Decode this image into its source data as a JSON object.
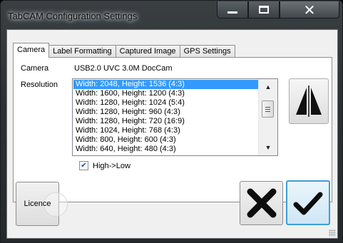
{
  "window": {
    "title": "TabCAM Configuration Settings"
  },
  "tabs": [
    {
      "label": "Camera",
      "active": true
    },
    {
      "label": "Label Formatting",
      "active": false
    },
    {
      "label": "Captured Image",
      "active": false
    },
    {
      "label": "GPS Settings",
      "active": false
    }
  ],
  "camera": {
    "label": "Camera",
    "value": "USB2.0 UVC 3.0M DocCam"
  },
  "resolution": {
    "label": "Resolution",
    "selected_index": 0,
    "options": [
      "Width: 2048, Height: 1536 (4:3)",
      "Width: 1600, Height: 1200 (4:3)",
      "Width: 1280, Height: 1024 (5:4)",
      "Width: 1280, Height: 960 (4:3)",
      "Width: 1280, Height: 720 (16:9)",
      "Width: 1024, Height: 768 (4:3)",
      "Width: 800, Height: 600 (4:3)",
      "Width: 640, Height: 480 (4:3)"
    ]
  },
  "sort_checkbox": {
    "label": "High->Low",
    "checked": true
  },
  "buttons": {
    "licence": "Licence"
  },
  "icons": {
    "minimize": "minimize-icon",
    "maximize": "maximize-icon",
    "close": "close-icon",
    "flip": "flip-horizontal-icon",
    "cancel": "cancel-x-icon",
    "ok": "checkmark-icon"
  },
  "colors": {
    "selection": "#3399ff",
    "ok_border": "#3c9fd8"
  }
}
